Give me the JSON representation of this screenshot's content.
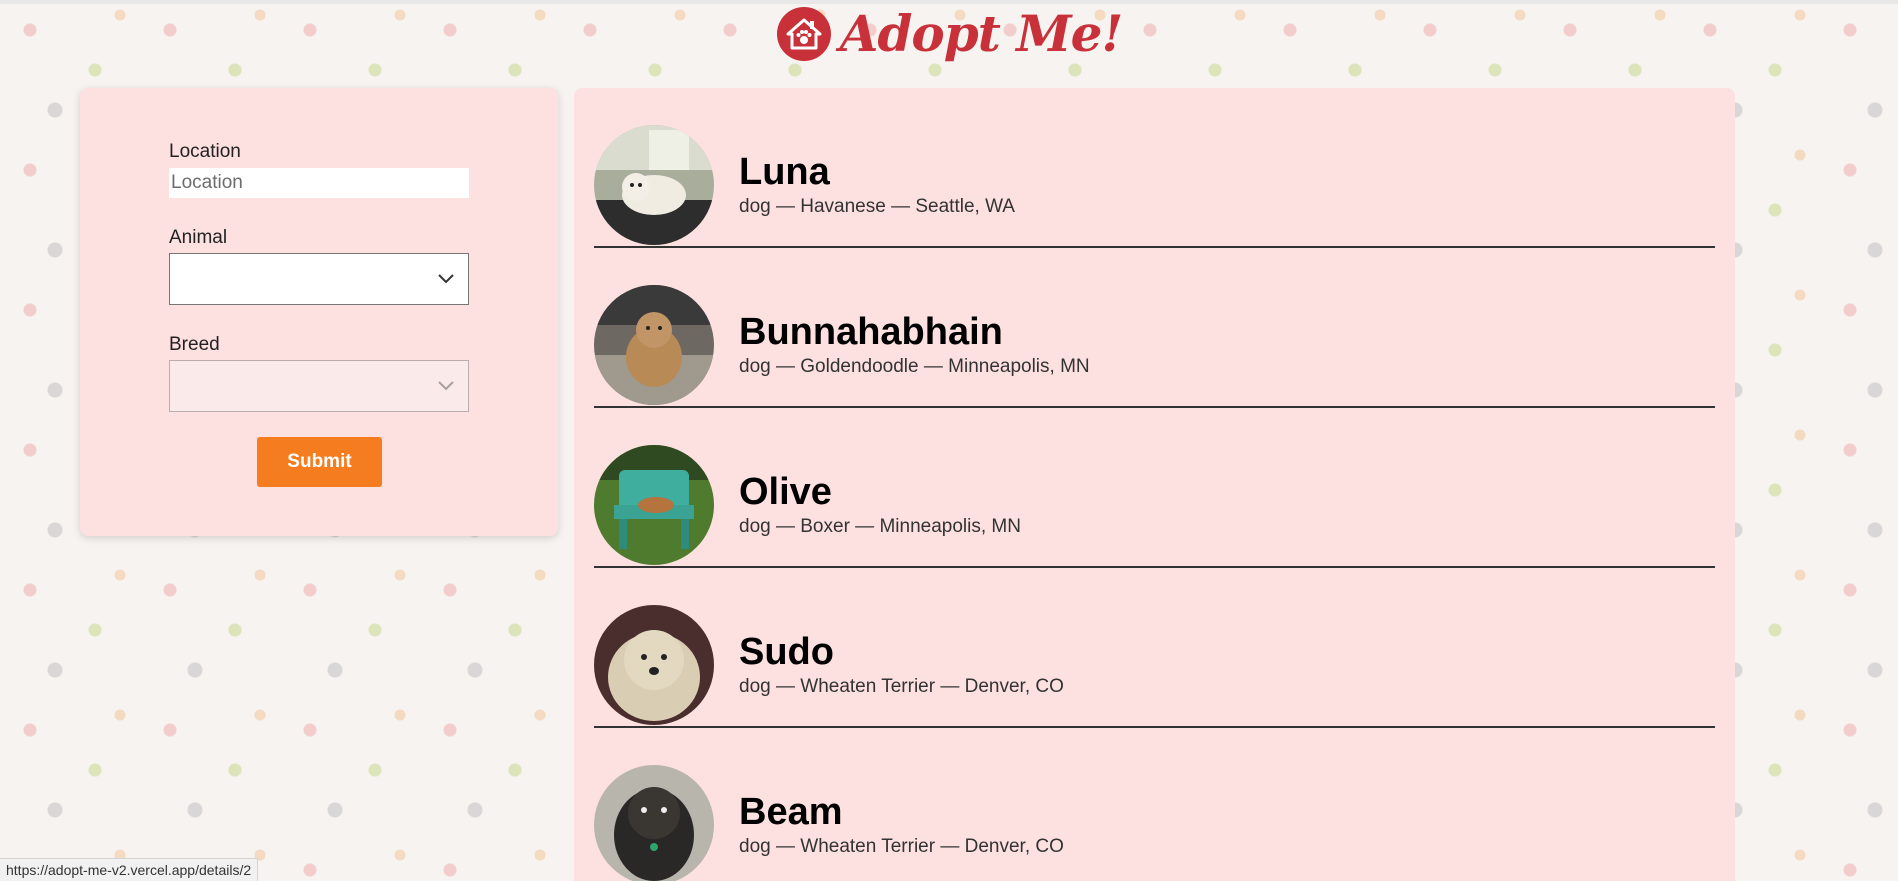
{
  "header": {
    "title": "Adopt Me!"
  },
  "search": {
    "location_label": "Location",
    "location_placeholder": "Location",
    "location_value": "",
    "animal_label": "Animal",
    "animal_value": "",
    "breed_label": "Breed",
    "breed_value": "",
    "submit_label": "Submit"
  },
  "pets": [
    {
      "name": "Luna",
      "description": "dog — Havanese — Seattle, WA"
    },
    {
      "name": "Bunnahabhain",
      "description": "dog — Goldendoodle — Minneapolis, MN"
    },
    {
      "name": "Olive",
      "description": "dog — Boxer — Minneapolis, MN"
    },
    {
      "name": "Sudo",
      "description": "dog — Wheaten Terrier — Denver, CO"
    },
    {
      "name": "Beam",
      "description": "dog — Wheaten Terrier — Denver, CO"
    }
  ],
  "status_bar": {
    "url": "https://adopt-me-v2.vercel.app/details/2"
  },
  "colors": {
    "brand": "#c8313a",
    "panel": "#fde0e0",
    "submit": "#f57c1f"
  }
}
